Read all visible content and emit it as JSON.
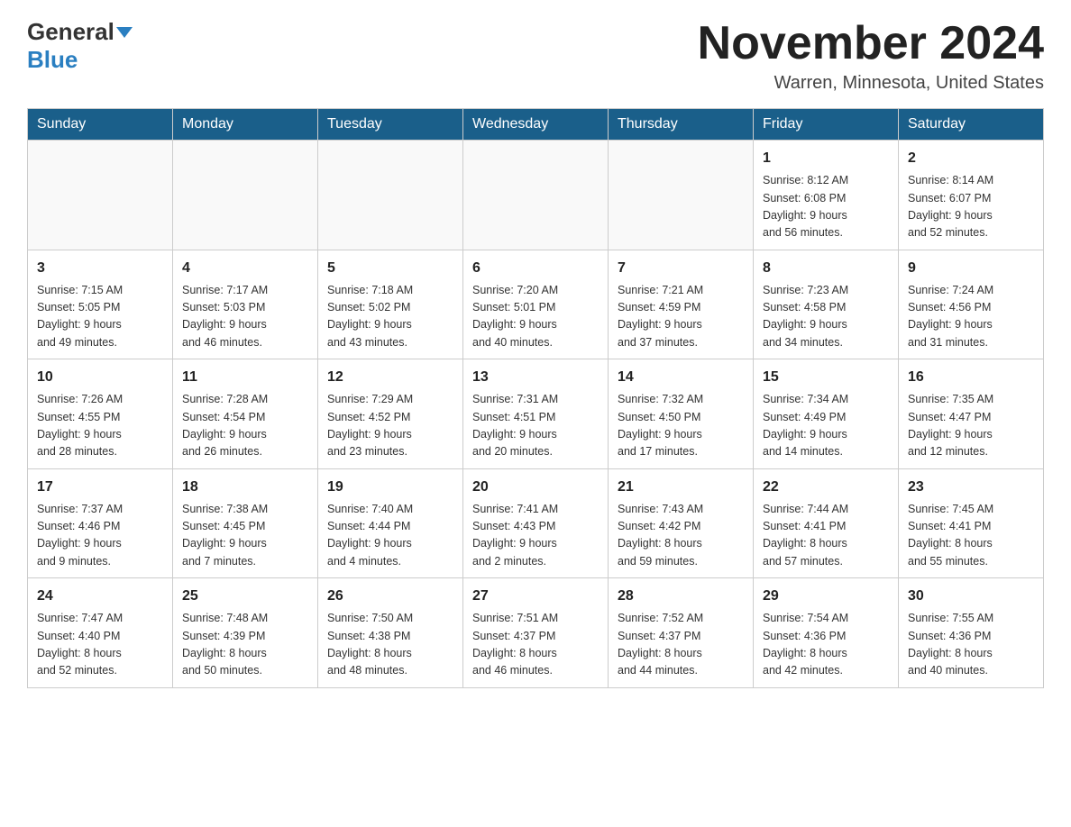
{
  "header": {
    "logo_general": "General",
    "logo_blue": "Blue",
    "month_title": "November 2024",
    "location": "Warren, Minnesota, United States"
  },
  "weekdays": [
    "Sunday",
    "Monday",
    "Tuesday",
    "Wednesday",
    "Thursday",
    "Friday",
    "Saturday"
  ],
  "weeks": [
    [
      {
        "day": "",
        "info": ""
      },
      {
        "day": "",
        "info": ""
      },
      {
        "day": "",
        "info": ""
      },
      {
        "day": "",
        "info": ""
      },
      {
        "day": "",
        "info": ""
      },
      {
        "day": "1",
        "info": "Sunrise: 8:12 AM\nSunset: 6:08 PM\nDaylight: 9 hours\nand 56 minutes."
      },
      {
        "day": "2",
        "info": "Sunrise: 8:14 AM\nSunset: 6:07 PM\nDaylight: 9 hours\nand 52 minutes."
      }
    ],
    [
      {
        "day": "3",
        "info": "Sunrise: 7:15 AM\nSunset: 5:05 PM\nDaylight: 9 hours\nand 49 minutes."
      },
      {
        "day": "4",
        "info": "Sunrise: 7:17 AM\nSunset: 5:03 PM\nDaylight: 9 hours\nand 46 minutes."
      },
      {
        "day": "5",
        "info": "Sunrise: 7:18 AM\nSunset: 5:02 PM\nDaylight: 9 hours\nand 43 minutes."
      },
      {
        "day": "6",
        "info": "Sunrise: 7:20 AM\nSunset: 5:01 PM\nDaylight: 9 hours\nand 40 minutes."
      },
      {
        "day": "7",
        "info": "Sunrise: 7:21 AM\nSunset: 4:59 PM\nDaylight: 9 hours\nand 37 minutes."
      },
      {
        "day": "8",
        "info": "Sunrise: 7:23 AM\nSunset: 4:58 PM\nDaylight: 9 hours\nand 34 minutes."
      },
      {
        "day": "9",
        "info": "Sunrise: 7:24 AM\nSunset: 4:56 PM\nDaylight: 9 hours\nand 31 minutes."
      }
    ],
    [
      {
        "day": "10",
        "info": "Sunrise: 7:26 AM\nSunset: 4:55 PM\nDaylight: 9 hours\nand 28 minutes."
      },
      {
        "day": "11",
        "info": "Sunrise: 7:28 AM\nSunset: 4:54 PM\nDaylight: 9 hours\nand 26 minutes."
      },
      {
        "day": "12",
        "info": "Sunrise: 7:29 AM\nSunset: 4:52 PM\nDaylight: 9 hours\nand 23 minutes."
      },
      {
        "day": "13",
        "info": "Sunrise: 7:31 AM\nSunset: 4:51 PM\nDaylight: 9 hours\nand 20 minutes."
      },
      {
        "day": "14",
        "info": "Sunrise: 7:32 AM\nSunset: 4:50 PM\nDaylight: 9 hours\nand 17 minutes."
      },
      {
        "day": "15",
        "info": "Sunrise: 7:34 AM\nSunset: 4:49 PM\nDaylight: 9 hours\nand 14 minutes."
      },
      {
        "day": "16",
        "info": "Sunrise: 7:35 AM\nSunset: 4:47 PM\nDaylight: 9 hours\nand 12 minutes."
      }
    ],
    [
      {
        "day": "17",
        "info": "Sunrise: 7:37 AM\nSunset: 4:46 PM\nDaylight: 9 hours\nand 9 minutes."
      },
      {
        "day": "18",
        "info": "Sunrise: 7:38 AM\nSunset: 4:45 PM\nDaylight: 9 hours\nand 7 minutes."
      },
      {
        "day": "19",
        "info": "Sunrise: 7:40 AM\nSunset: 4:44 PM\nDaylight: 9 hours\nand 4 minutes."
      },
      {
        "day": "20",
        "info": "Sunrise: 7:41 AM\nSunset: 4:43 PM\nDaylight: 9 hours\nand 2 minutes."
      },
      {
        "day": "21",
        "info": "Sunrise: 7:43 AM\nSunset: 4:42 PM\nDaylight: 8 hours\nand 59 minutes."
      },
      {
        "day": "22",
        "info": "Sunrise: 7:44 AM\nSunset: 4:41 PM\nDaylight: 8 hours\nand 57 minutes."
      },
      {
        "day": "23",
        "info": "Sunrise: 7:45 AM\nSunset: 4:41 PM\nDaylight: 8 hours\nand 55 minutes."
      }
    ],
    [
      {
        "day": "24",
        "info": "Sunrise: 7:47 AM\nSunset: 4:40 PM\nDaylight: 8 hours\nand 52 minutes."
      },
      {
        "day": "25",
        "info": "Sunrise: 7:48 AM\nSunset: 4:39 PM\nDaylight: 8 hours\nand 50 minutes."
      },
      {
        "day": "26",
        "info": "Sunrise: 7:50 AM\nSunset: 4:38 PM\nDaylight: 8 hours\nand 48 minutes."
      },
      {
        "day": "27",
        "info": "Sunrise: 7:51 AM\nSunset: 4:37 PM\nDaylight: 8 hours\nand 46 minutes."
      },
      {
        "day": "28",
        "info": "Sunrise: 7:52 AM\nSunset: 4:37 PM\nDaylight: 8 hours\nand 44 minutes."
      },
      {
        "day": "29",
        "info": "Sunrise: 7:54 AM\nSunset: 4:36 PM\nDaylight: 8 hours\nand 42 minutes."
      },
      {
        "day": "30",
        "info": "Sunrise: 7:55 AM\nSunset: 4:36 PM\nDaylight: 8 hours\nand 40 minutes."
      }
    ]
  ]
}
